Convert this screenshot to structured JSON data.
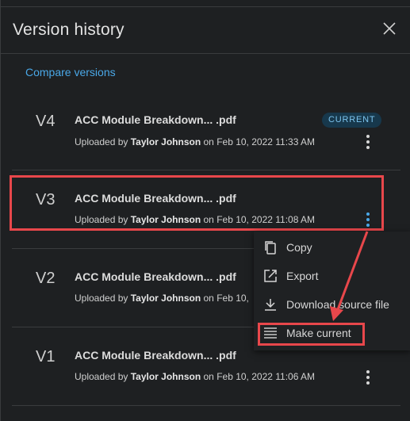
{
  "panel": {
    "title": "Version history",
    "close_icon": "close-icon",
    "compare_label": "Compare versions",
    "accent_color": "#4aa8e8",
    "highlight_color": "#e8474b"
  },
  "versions": [
    {
      "label": "V4",
      "filename": "ACC Module Breakdown... .pdf",
      "uploaded_prefix": "Uploaded by ",
      "uploader": "Taylor Johnson",
      "uploaded_suffix": " on Feb 10, 2022 11:33 AM",
      "badge": "CURRENT"
    },
    {
      "label": "V3",
      "filename": "ACC Module Breakdown... .pdf",
      "uploaded_prefix": "Uploaded by ",
      "uploader": "Taylor Johnson",
      "uploaded_suffix": " on Feb 10, 2022 11:08 AM"
    },
    {
      "label": "V2",
      "filename": "ACC Module Breakdown... .pdf",
      "uploaded_prefix": "Uploaded by ",
      "uploader": "Taylor Johnson",
      "uploaded_suffix": " on Feb 10,"
    },
    {
      "label": "V1",
      "filename": "ACC Module Breakdown... .pdf",
      "uploaded_prefix": "Uploaded by ",
      "uploader": "Taylor Johnson",
      "uploaded_suffix": " on Feb 10, 2022 11:06 AM"
    }
  ],
  "menu": {
    "items": [
      {
        "label": "Copy",
        "icon": "copy-icon"
      },
      {
        "label": "Export",
        "icon": "export-icon"
      },
      {
        "label": "Download source file",
        "icon": "download-icon"
      },
      {
        "label": "Make current",
        "icon": "list-icon"
      }
    ]
  }
}
